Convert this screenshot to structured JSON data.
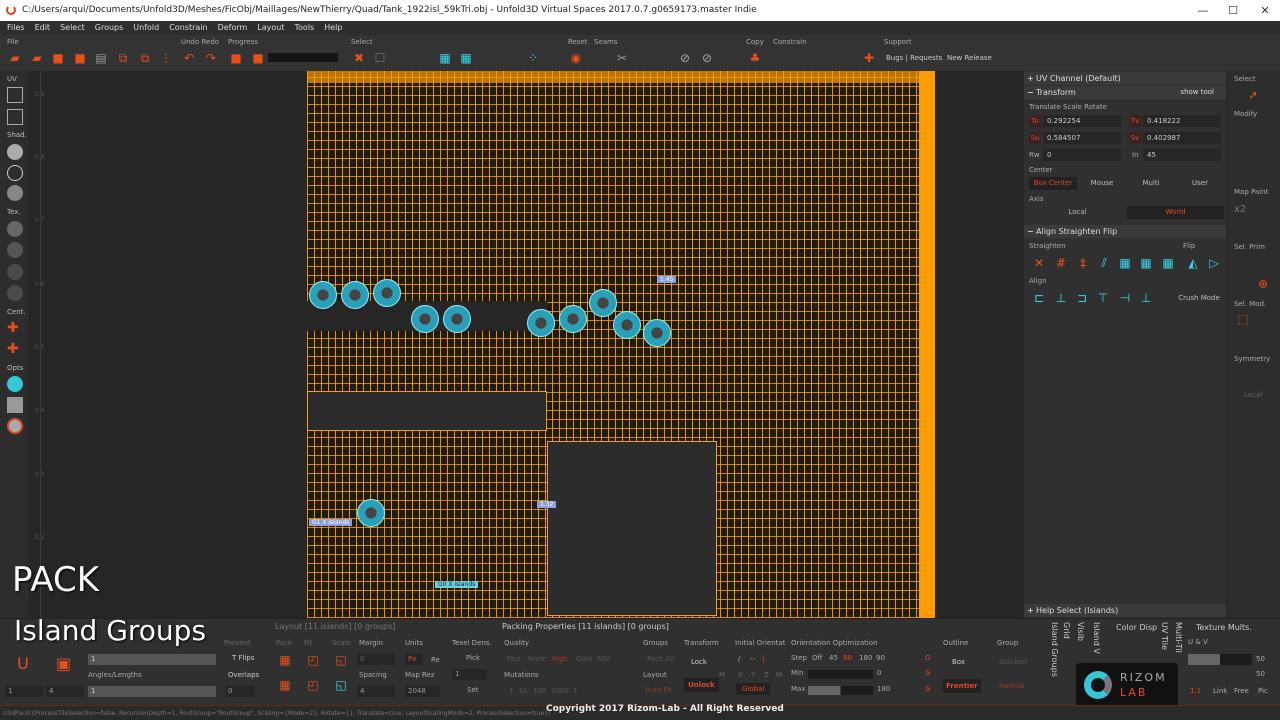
{
  "window": {
    "title": "C:/Users/arqui/Documents/Unfold3D/Meshes/FicObj/Maillages/NewThierry/Quad/Tank_1922isl_59kTri.obj - Unfold3D Virtual Spaces 2017.0.7.g0659173.master Indie",
    "minimize": "—",
    "maximize": "☐",
    "close": "✕"
  },
  "menu": [
    "Files",
    "Edit",
    "Select",
    "Groups",
    "Unfold",
    "Constrain",
    "Deform",
    "Layout",
    "Tools",
    "Help"
  ],
  "toolbar": {
    "labels": {
      "file": "File",
      "undo_redo": "Undo Redo",
      "progress": "Progress",
      "select": "Select",
      "reset": "Reset",
      "seams": "Seams",
      "copy": "Copy",
      "constrain": "Constrain",
      "support": "Support"
    },
    "links": {
      "bugs": "Bugs | Requests",
      "release": "New Release"
    },
    "progress_value": 0
  },
  "leftbar": {
    "uv": "UV",
    "shad": "Shad.",
    "tex": "Tex.",
    "cent": "Cent.",
    "opts": "Opts"
  },
  "ruler": [
    "0.9",
    "0.8",
    "0.7",
    "0.6",
    "0.5",
    "0.4",
    "0.3",
    "0.2"
  ],
  "viewport": {
    "group_labels": [
      "G1 X islands",
      "G0 X islands"
    ],
    "badges": [
      "1.45",
      "1.32"
    ]
  },
  "uv_panel": {
    "header": "UV Channel (Default)",
    "help": "?",
    "transform": {
      "title": "Transform",
      "show_tool": "show tool",
      "subtitle": "Translate Scale Rotate",
      "tu_label": "Tu",
      "tu": "0.292254",
      "tv_label": "Tv",
      "tv": "0.418222",
      "su_label": "Su",
      "su": "0.584507",
      "sv_label": "Sv",
      "sv": "0.402987",
      "rw_label": "Rw",
      "rw": "0",
      "in_label": "In",
      "in": "45",
      "center_label": "Center",
      "center_options": [
        "Box Center",
        "Mouse",
        "Multi",
        "User"
      ],
      "axis_label": "Axis",
      "axis_options": [
        "Local",
        "World"
      ]
    },
    "align": {
      "title": "Align Straighten Flip",
      "straighten": "Straighten",
      "flip": "Flip",
      "align": "Align",
      "crush": "Crush Mode"
    },
    "help_select": "Help Select (Islands)"
  },
  "toolcol": {
    "select": "Select",
    "modify": "Modify",
    "map_paint": "Map Paint",
    "x2": "x2",
    "sel_prim": "Sel. Prim",
    "sel_mod": "Sel. Mod.",
    "symmetry": "Symmetry",
    "local": "Local"
  },
  "overlay": {
    "title": "PACK",
    "subtitle": "Island Groups"
  },
  "island_groups_panel": {
    "prevent": "Prevent",
    "tflips": "T Flips",
    "overlaps": "Overlaps",
    "angles": "Angles/Lengths",
    "v1": "1",
    "v2": "1",
    "u_val": "1",
    "o_val": "4",
    "overlap_val": "0"
  },
  "layout_panel": {
    "title": "Layout [11 islands] [0 groups]",
    "pack": "Pack",
    "fit": "Fit",
    "scale": "Scale",
    "margin": "Margin",
    "margin_val": "0",
    "spacing": "Spacing",
    "spacing_val": "4",
    "units": "Units",
    "px": "Px",
    "re": "Re",
    "map_rez": "Map Rez",
    "map_rez_val": "2048",
    "texel": "Texel Dens.",
    "pick": "Pick",
    "texel_val": "1",
    "set": "Set"
  },
  "packing_panel": {
    "title": "Packing Properties [11 islands] [0 groups]",
    "quality": "Quality",
    "quality_opts": [
      "Fast",
      "Norm",
      "High",
      "Gold",
      "500"
    ],
    "mutations": "Mutations",
    "mutation_opts": [
      "1",
      "10",
      "100",
      "1000",
      "1"
    ],
    "groups": "Groups",
    "pack_all": "Pack All",
    "layout": "Layout",
    "auto_fit": "Auto Fit",
    "transform": "Transform",
    "lock": "Lock",
    "unlock": "Unlock",
    "m": "M",
    "initial": "Initial Orientat",
    "init_opts": [
      "/",
      "--",
      "|"
    ],
    "xyz": [
      "X",
      "Y",
      "Z",
      "M"
    ],
    "global": "Global",
    "orient": "Orientation Optimization",
    "step": "Step",
    "step_opts": [
      "Off",
      "45",
      "90",
      "180"
    ],
    "step_val": "90",
    "min": "Min",
    "min_val": "0",
    "max": "Max",
    "max_val": "180",
    "g": "G",
    "outline": "Outline",
    "box": "Box",
    "frontier": "Frontier",
    "group": "Group",
    "stacked": "Stacked",
    "normal": "Normal"
  },
  "vtabs": [
    "Island Groups",
    "Grid",
    "Visib",
    "Island V",
    "UV Tile",
    "Multi-Til"
  ],
  "color_disp": "Color Disp",
  "texture_mults": {
    "title": "Texture Mults.",
    "uv": "U & V",
    "v1": "50",
    "v2": "50",
    "buttons": [
      "1:1",
      "Link",
      "Free",
      "Pic"
    ],
    "fill": 0.5
  },
  "rizom": {
    "t1": "RIZOM",
    "t2": "LAB"
  },
  "status": "U3dPack({ProcessTileSelection=false, RecursionDepth=1, RootGroup=\"RootGroup\", Scaling={Mode=2}, Rotate={}, Translate=true, LayoutScalingMode=2, ProcessSelection=true})",
  "copyright": "Copyright 2017 Rizom-Lab - All Right Reserved"
}
